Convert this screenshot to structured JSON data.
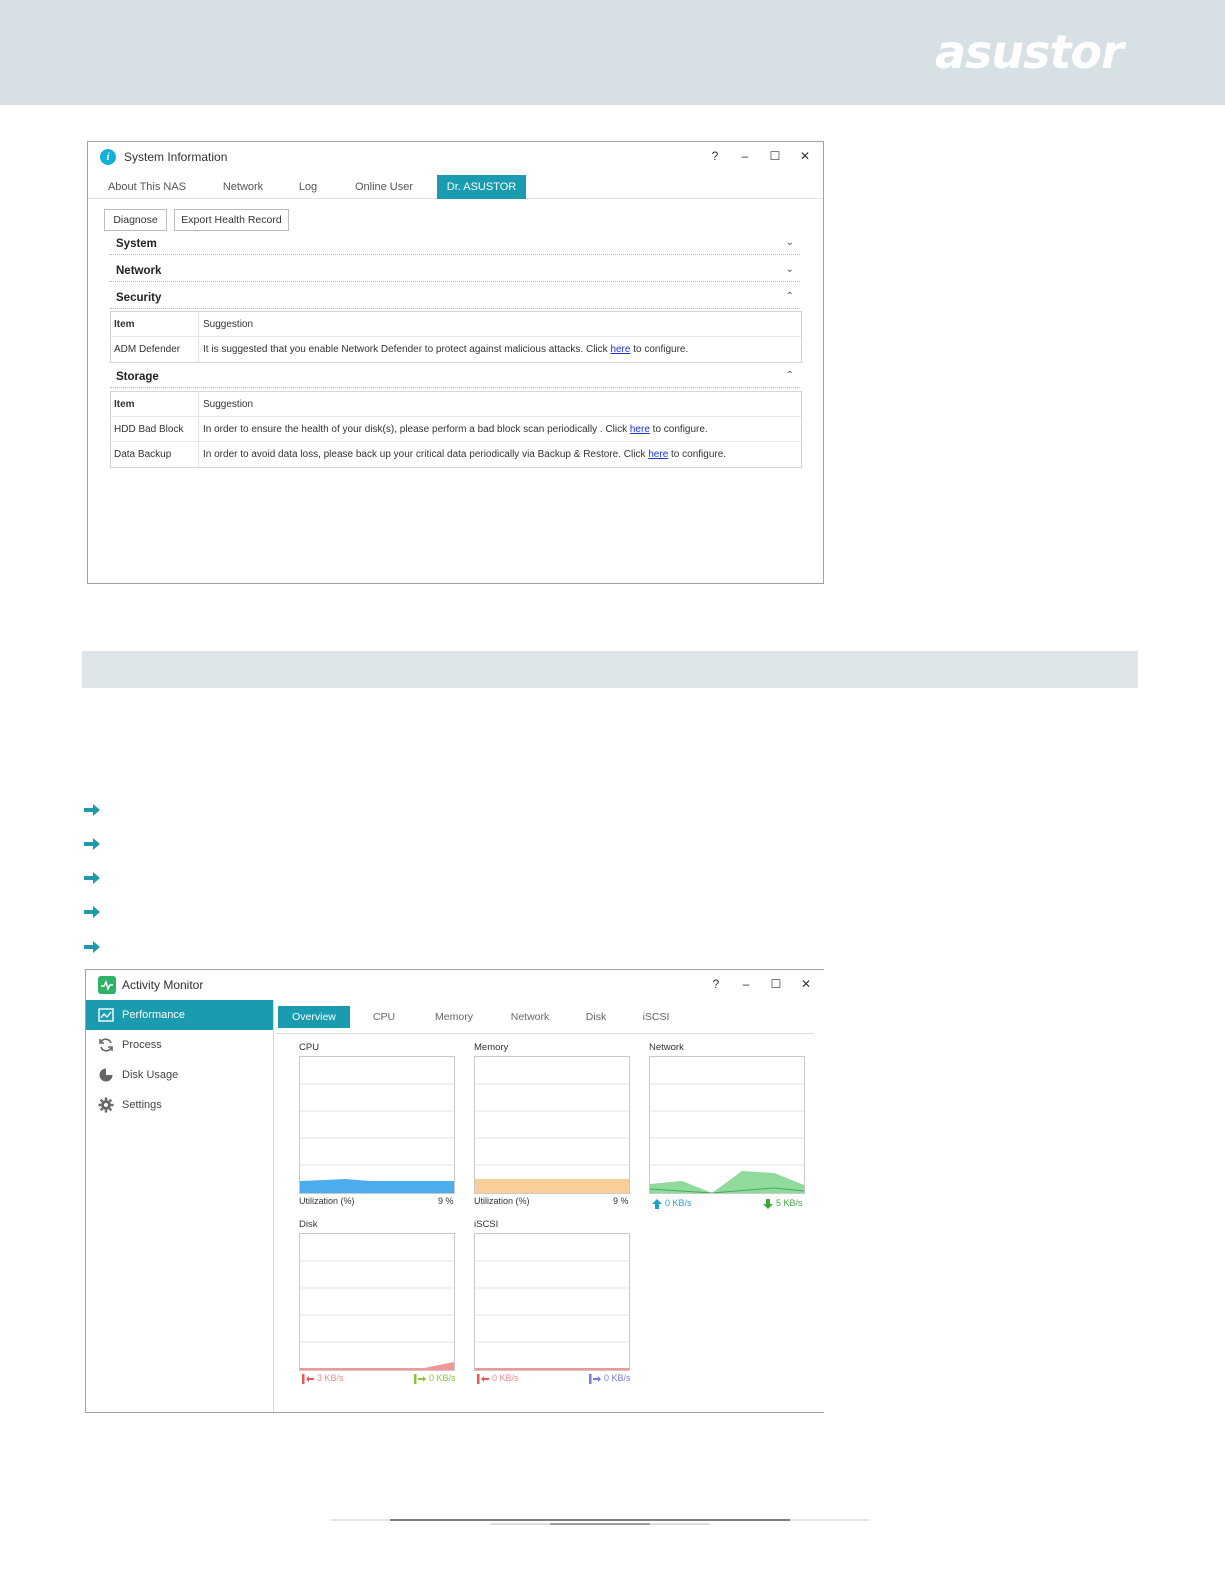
{
  "brand": {
    "logo_text": "asustor"
  },
  "system_info": {
    "title": "System Information",
    "controls": [
      "?",
      "–",
      "☐",
      "✕"
    ],
    "tabs": [
      {
        "label": "About This NAS"
      },
      {
        "label": "Network"
      },
      {
        "label": "Log"
      },
      {
        "label": "Online User"
      },
      {
        "label": "Dr. ASUSTOR",
        "active": true
      }
    ],
    "buttons": {
      "diagnose": "Diagnose",
      "export": "Export Health Record"
    },
    "sections": {
      "system": "System",
      "network": "Network",
      "security": "Security",
      "storage": "Storage"
    },
    "table_headers": {
      "item": "Item",
      "suggestion": "Suggestion"
    },
    "security_rows": [
      {
        "item": "ADM Defender",
        "pre": "It is suggested that you enable Network Defender to protect against malicious attacks. Click ",
        "link": "here",
        "post": " to configure."
      }
    ],
    "storage_rows": [
      {
        "item": "HDD Bad Block",
        "pre": "In order to ensure the health of your disk(s), please perform a bad block scan periodically . Click ",
        "link": "here",
        "post": " to configure."
      },
      {
        "item": "Data Backup",
        "pre": "In order to avoid data loss, please back up your critical data periodically via Backup & Restore. Click ",
        "link": "here",
        "post": " to configure."
      }
    ]
  },
  "activity_monitor": {
    "title": "Activity Monitor",
    "sidebar": [
      {
        "label": "Performance",
        "icon": "chart-icon",
        "active": true
      },
      {
        "label": "Process",
        "icon": "refresh-icon"
      },
      {
        "label": "Disk Usage",
        "icon": "pie-icon"
      },
      {
        "label": "Settings",
        "icon": "gear-icon"
      }
    ],
    "tabs": [
      {
        "label": "Overview",
        "active": true
      },
      {
        "label": "CPU"
      },
      {
        "label": "Memory"
      },
      {
        "label": "Network"
      },
      {
        "label": "Disk"
      },
      {
        "label": "iSCSI"
      }
    ],
    "panels": {
      "cpu": {
        "title": "CPU",
        "stat_label": "Utilization (%)",
        "stat_value": "9 %",
        "color": "#3aa4ea"
      },
      "memory": {
        "title": "Memory",
        "stat_label": "Utilization (%)",
        "stat_value": "9 %",
        "color": "#f7c98f"
      },
      "network": {
        "title": "Network",
        "up": "0 KB/s",
        "down": "5 KB/s",
        "color": "#7cd58a"
      },
      "disk": {
        "title": "Disk",
        "read": "3 KB/s",
        "write": "0 KB/s",
        "color": "#f08c8c"
      },
      "iscsi": {
        "title": "iSCSI",
        "read": "0 KB/s",
        "write": "0 KB/s",
        "color": "#f08c8c"
      }
    }
  },
  "colors": {
    "accent": "#1b9bb0",
    "header_band": "#d6e0e5",
    "arrow": "#1e9aaa"
  }
}
